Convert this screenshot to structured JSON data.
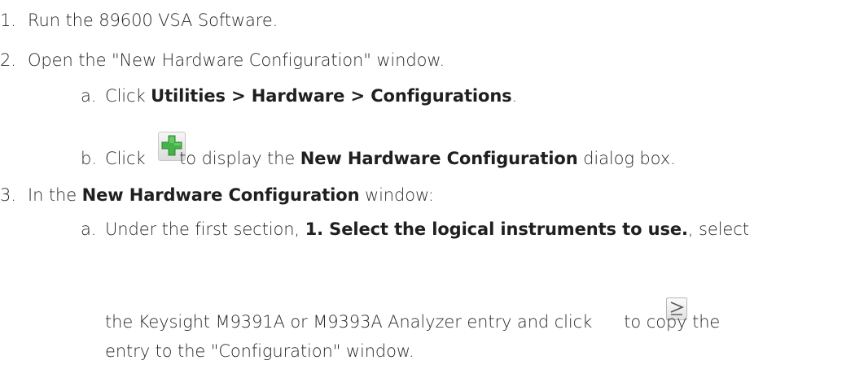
{
  "steps": [
    {
      "num": "1.",
      "text": "Run the 89600 VSA Software."
    },
    {
      "num": "2.",
      "text": "Open the \"New Hardware Configuration\" window.",
      "substeps": [
        {
          "num": "a.",
          "prefix": "Click ",
          "bold": "Utilities > Hardware > Configurations",
          "suffix": "."
        },
        {
          "num": "b.",
          "prefix": "Click ",
          "icon": "green-plus-icon",
          "middle": "to display the ",
          "bold": "New Hardware Configuration",
          "suffix": " dialog box."
        }
      ]
    },
    {
      "num": "3.",
      "prefix": "In the ",
      "bold": "New Hardware Configuration",
      "suffix": " window:",
      "substeps": [
        {
          "num": "a.",
          "prefix": "Under the first section, ",
          "bold": "1. Select the logical instruments to use.",
          "suffix": ", select",
          "line2_prefix": "the Keysight M9391A or M9393A Analyzer entry and click ",
          "icon": "greater-than-arrow-icon",
          "line2_suffix": " to copy the",
          "line3": "entry to the \"Configuration\" window."
        }
      ]
    }
  ],
  "colors": {
    "text": "#2a2a2a",
    "plus_green": "#3aa83a"
  }
}
